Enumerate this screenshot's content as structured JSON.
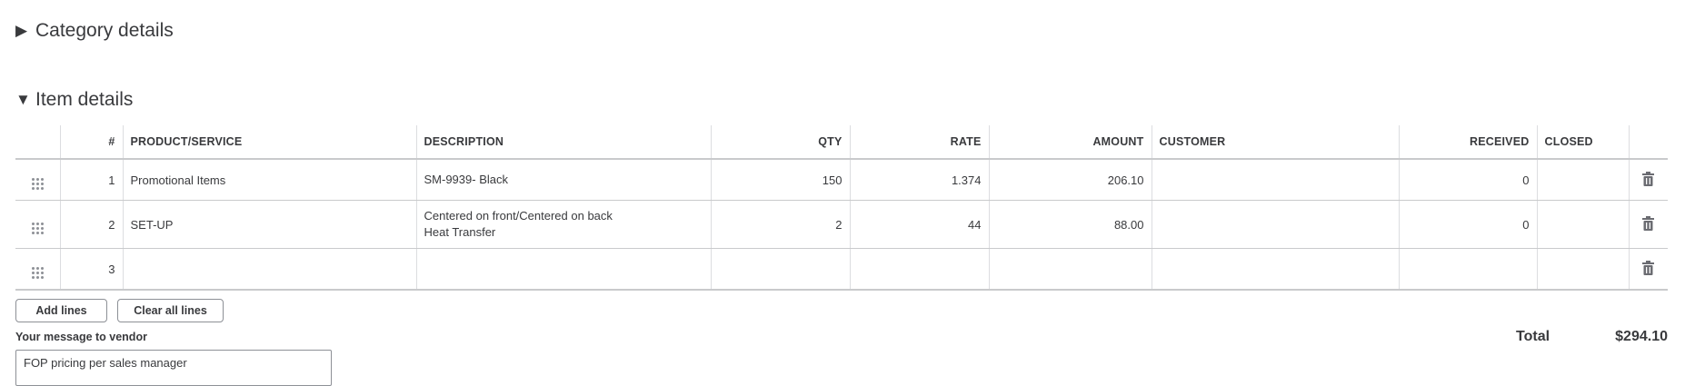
{
  "category_section": {
    "caret": "▶",
    "title": "Category details"
  },
  "item_section": {
    "caret": "▼",
    "title": "Item details"
  },
  "table": {
    "headers": {
      "num": "#",
      "product": "PRODUCT/SERVICE",
      "description": "DESCRIPTION",
      "qty": "QTY",
      "rate": "RATE",
      "amount": "AMOUNT",
      "customer": "CUSTOMER",
      "received": "RECEIVED",
      "closed": "CLOSED"
    },
    "rows": [
      {
        "num": "1",
        "product": "Promotional Items",
        "description_lines": [
          "SM-9939- Black"
        ],
        "qty": "150",
        "rate": "1.374",
        "amount": "206.10",
        "customer": "",
        "received": "0",
        "closed": ""
      },
      {
        "num": "2",
        "product": "SET-UP",
        "description_lines": [
          "Centered on front/Centered on back",
          "Heat Transfer"
        ],
        "qty": "2",
        "rate": "44",
        "amount": "88.00",
        "customer": "",
        "received": "0",
        "closed": ""
      },
      {
        "num": "3",
        "product": "",
        "description_lines": [
          ""
        ],
        "qty": "",
        "rate": "",
        "amount": "",
        "customer": "",
        "received": "",
        "closed": ""
      }
    ]
  },
  "buttons": {
    "add_lines": "Add lines",
    "clear_all_lines": "Clear all lines"
  },
  "message": {
    "label": "Your message to vendor",
    "value": "FOP pricing per sales manager"
  },
  "total": {
    "label": "Total",
    "value": "$294.10"
  },
  "icons": {
    "drag": "drag-handle-icon",
    "delete": "trash-icon",
    "expand": "caret-right-icon",
    "collapse": "caret-down-icon"
  }
}
